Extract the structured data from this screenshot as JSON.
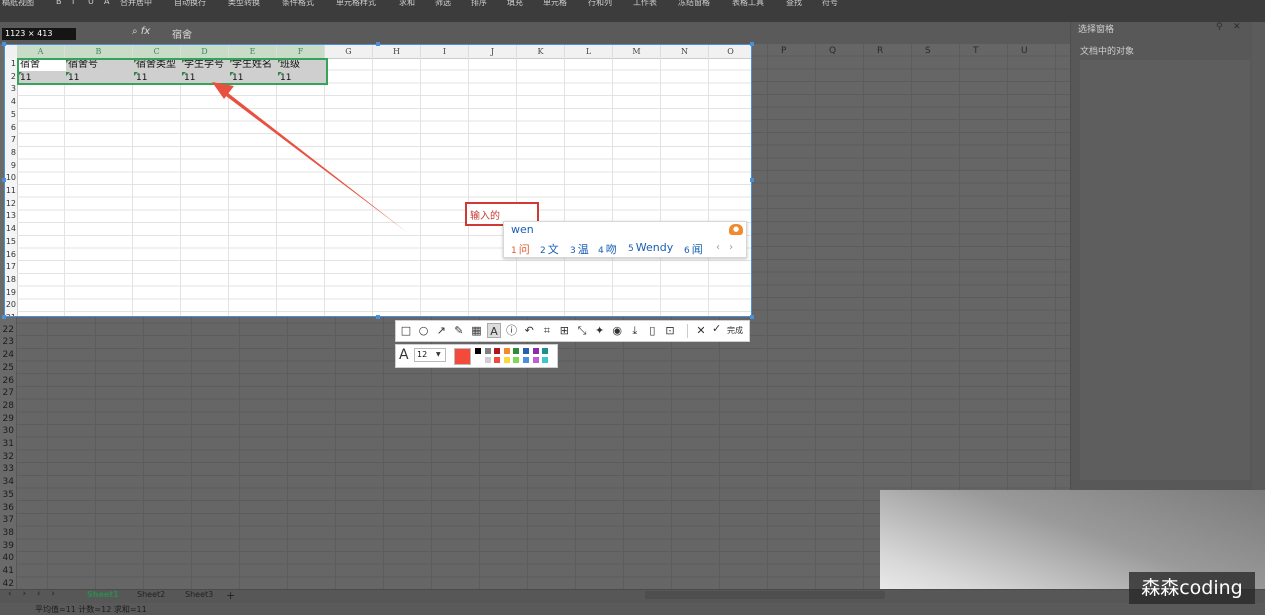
{
  "ribbon": {
    "items": [
      "稿纸视图",
      "B",
      "I",
      "U",
      "A",
      "合并居中",
      "自动换行",
      "类型转换",
      "条件格式",
      "单元格样式",
      "求和",
      "筛选",
      "排序",
      "填充",
      "单元格",
      "行和列",
      "工作表",
      "冻结窗格",
      "表格工具",
      "查找",
      "符号"
    ]
  },
  "formula_bar": {
    "size_badge": "1123 × 413",
    "fx_label": "fx",
    "value": "宿舍"
  },
  "right_panel": {
    "title": "选择窗格",
    "subtitle": "文档中的对象"
  },
  "columns": [
    "A",
    "B",
    "C",
    "D",
    "E",
    "F",
    "G",
    "H",
    "I",
    "J",
    "K",
    "L",
    "M",
    "N",
    "O",
    "P",
    "Q",
    "R",
    "S",
    "T",
    "U"
  ],
  "rows": [
    "1",
    "2",
    "3",
    "4",
    "5",
    "6",
    "7",
    "8",
    "9",
    "10",
    "11",
    "12",
    "13",
    "14",
    "15",
    "16",
    "17",
    "18",
    "19",
    "20",
    "21",
    "22",
    "23",
    "24",
    "25",
    "26",
    "27",
    "28",
    "29",
    "30",
    "31",
    "32",
    "33",
    "34",
    "35",
    "36",
    "37",
    "38",
    "39",
    "40",
    "41",
    "42"
  ],
  "sheet": {
    "headers": [
      "宿舍",
      "宿舍号",
      "宿舍类型",
      "学生学号",
      "学生姓名",
      "班级"
    ],
    "row2": [
      "11",
      "11",
      "11",
      "11",
      "11",
      "11"
    ]
  },
  "annotation": {
    "text_value": "输入的",
    "arrow_color": "#e8503f",
    "box_color": "#cf3a36"
  },
  "ime": {
    "input": "wen",
    "candidates": [
      {
        "n": "1",
        "text": "问"
      },
      {
        "n": "2",
        "text": "文"
      },
      {
        "n": "3",
        "text": "温"
      },
      {
        "n": "4",
        "text": "吻"
      },
      {
        "n": "5",
        "text": "Wendy"
      },
      {
        "n": "6",
        "text": "闻"
      }
    ],
    "nav": "‹ ›"
  },
  "toolbar": {
    "icons": [
      "rectangle-tool-icon",
      "ellipse-tool-icon",
      "arrow-tool-icon",
      "pencil-tool-icon",
      "mosaic-tool-icon",
      "text-tool-icon",
      "number-marker-icon",
      "undo-icon",
      "ocr-icon",
      "translate-icon",
      "long-screenshot-icon",
      "pin-icon",
      "record-icon",
      "save-icon",
      "copy-icon",
      "bookmark-icon"
    ],
    "done_label": "完成",
    "font_size": "12",
    "current_color": "#f44a3b",
    "palette": [
      "#000000",
      "#7f7f7f",
      "#b3141b",
      "#f28a2e",
      "#2e8b3a",
      "#2a5db0",
      "#8a2cb0",
      "#1c8f8f",
      "#ffffff",
      "#cfcfcf",
      "#f44a3b",
      "#ffd83b",
      "#7ed957",
      "#4a90e2",
      "#c25bd6",
      "#3cc9c9"
    ]
  },
  "tabs": {
    "sheets": [
      "Sheet1",
      "Sheet2",
      "Sheet3"
    ],
    "add": "+"
  },
  "status": {
    "text": "平均值=11  计数=12  求和=11"
  },
  "watermark": "森森coding"
}
